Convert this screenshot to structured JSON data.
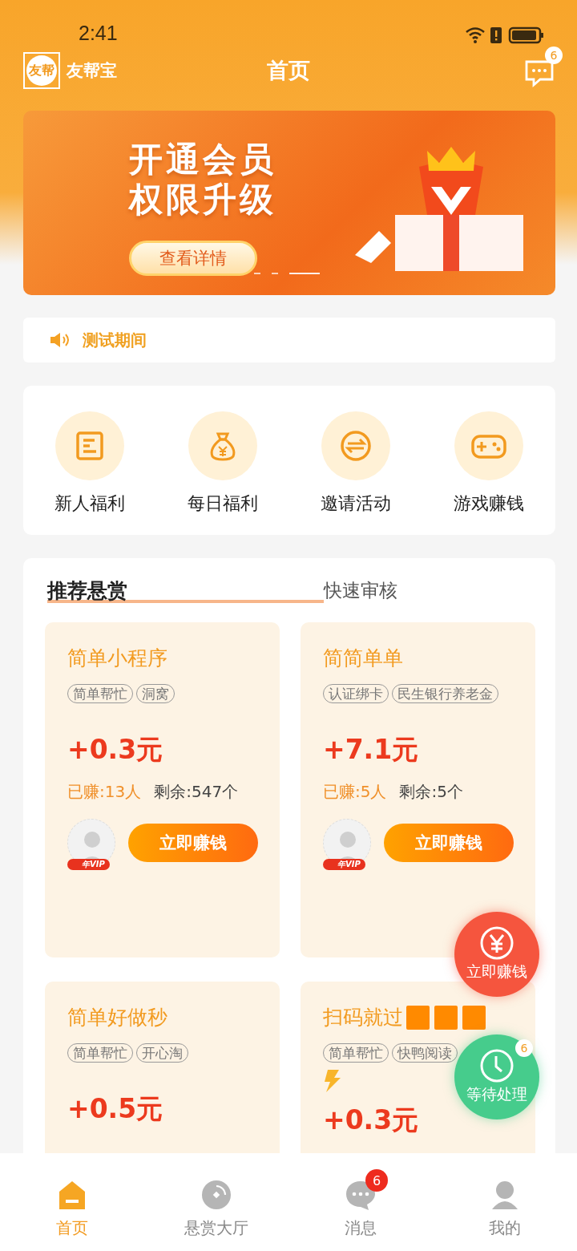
{
  "status_bar": {
    "time": "2:41"
  },
  "header": {
    "logo_text": "友帮",
    "app_name": "友帮宝",
    "title": "首页",
    "message_badge": "6"
  },
  "banner": {
    "headline": [
      "开通会员",
      "权限升级"
    ],
    "button": "查看详情",
    "dots": [
      {
        "selected": false
      },
      {
        "selected": false
      },
      {
        "selected": true
      }
    ]
  },
  "notice": {
    "text": "测试期间"
  },
  "quick_actions": [
    {
      "label": "新人福利"
    },
    {
      "label": "每日福利"
    },
    {
      "label": "邀请活动"
    },
    {
      "label": "游戏赚钱"
    }
  ],
  "task_tabs": [
    {
      "label": "推荐悬赏",
      "selected": true
    },
    {
      "label": "快速审核",
      "selected": false
    }
  ],
  "tasks": [
    {
      "title": "简单小程序",
      "tags": [
        "简单帮忙",
        "洞窝"
      ],
      "reward": "+0.3元",
      "earned": "已赚:13人",
      "remaining": "剩余:547个",
      "vip": "年VIP",
      "action": "立即赚钱"
    },
    {
      "title": "简简单单",
      "tags": [
        "认证绑卡",
        "民生银行养老金"
      ],
      "reward": "+7.1元",
      "earned": "已赚:5人",
      "remaining": "剩余:5个",
      "vip": "年VIP",
      "action": "立即赚钱"
    },
    {
      "title": "简单好做秒",
      "tags": [
        "简单帮忙",
        "开心淘"
      ],
      "reward": "+0.5元"
    },
    {
      "title": "扫码就过",
      "title_blocks": [
        {
          "kind": "square"
        },
        {
          "kind": "square"
        },
        {
          "kind": "square"
        }
      ],
      "tags": [
        "简单帮忙",
        "快鸭阅读"
      ],
      "reward": "+0.3元",
      "lightning": true
    }
  ],
  "floating": [
    {
      "kind": "earn",
      "label": "立即赚钱"
    },
    {
      "kind": "pending",
      "label": "等待处理",
      "badge": "6"
    }
  ],
  "bottom_nav": [
    {
      "label": "首页",
      "selected": true
    },
    {
      "label": "悬赏大厅",
      "selected": false
    },
    {
      "label": "消息",
      "selected": false,
      "badge": "6"
    },
    {
      "label": "我的",
      "selected": false
    }
  ]
}
